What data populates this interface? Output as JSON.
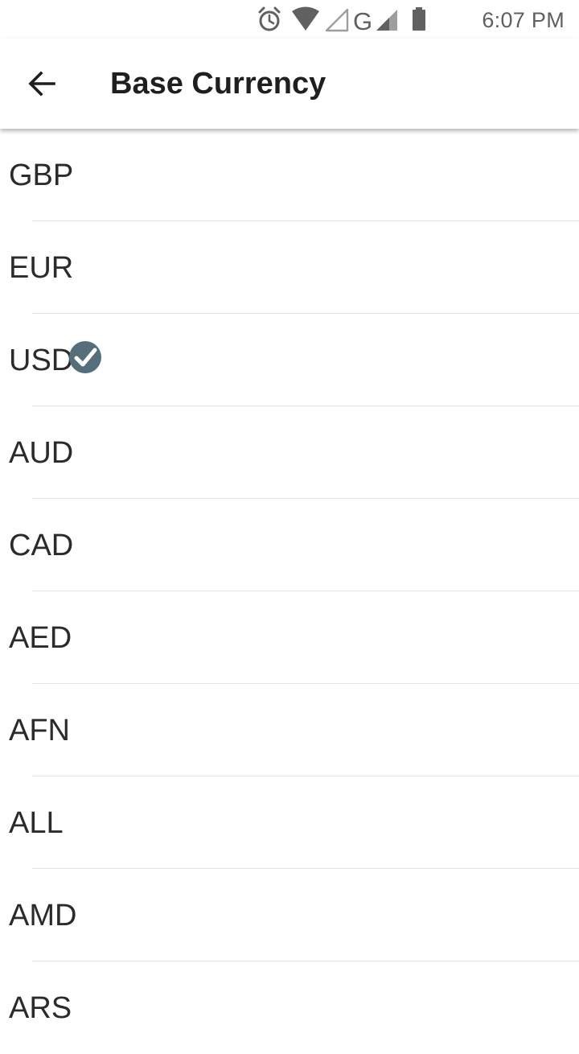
{
  "status_bar": {
    "time": "6:07 PM",
    "icons": [
      "alarm-icon",
      "wifi-icon",
      "signal-empty-icon",
      "network-type-g-icon",
      "signal-icon",
      "battery-icon"
    ],
    "network_type": "G",
    "icon_color": "#616161"
  },
  "app_bar": {
    "back_icon": "arrow-left-icon",
    "title": "Base Currency"
  },
  "currency_list": {
    "selected": "USD",
    "check_color": "#546e7a",
    "items": [
      {
        "code": "GBP"
      },
      {
        "code": "EUR"
      },
      {
        "code": "USD"
      },
      {
        "code": "AUD"
      },
      {
        "code": "CAD"
      },
      {
        "code": "AED"
      },
      {
        "code": "AFN"
      },
      {
        "code": "ALL"
      },
      {
        "code": "AMD"
      },
      {
        "code": "ARS"
      }
    ]
  }
}
